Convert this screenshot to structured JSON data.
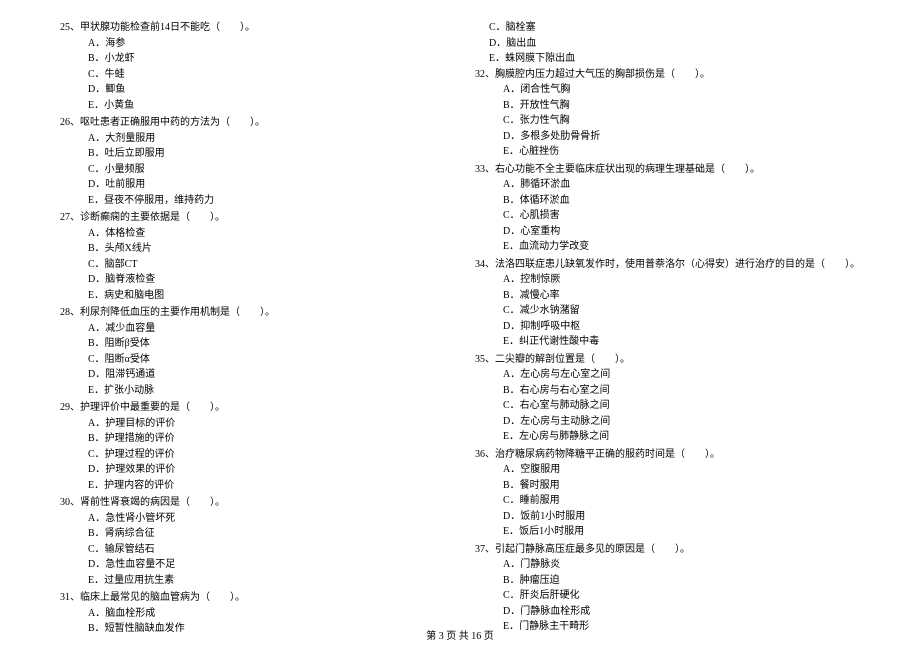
{
  "footer": "第 3 页 共 16 页",
  "left": {
    "questions": [
      {
        "num": "25、",
        "stem": "甲状腺功能检查前14日不能吃（　　）。",
        "options": [
          "A．海参",
          "B．小龙虾",
          "C．牛蛙",
          "D．鲫鱼",
          "E．小黄鱼"
        ]
      },
      {
        "num": "26、",
        "stem": "呕吐患者正确服用中药的方法为（　　）。",
        "options": [
          "A．大剂量服用",
          "B．吐后立即服用",
          "C．小量频服",
          "D．吐前服用",
          "E．昼夜不停服用，维持药力"
        ]
      },
      {
        "num": "27、",
        "stem": "诊断癫痫的主要依据是（　　）。",
        "options": [
          "A．体格检查",
          "B．头颅X线片",
          "C．脑部CT",
          "D．脑脊液检查",
          "E．病史和脑电图"
        ]
      },
      {
        "num": "28、",
        "stem": "利尿剂降低血压的主要作用机制是（　　）。",
        "options": [
          "A．减少血容量",
          "B．阻断β受体",
          "C．阻断α受体",
          "D．阻滞钙通道",
          "E．扩张小动脉"
        ]
      },
      {
        "num": "29、",
        "stem": "护理评价中最重要的是（　　）。",
        "options": [
          "A．护理目标的评价",
          "B．护理措施的评价",
          "C．护理过程的评价",
          "D．护理效果的评价",
          "E．护理内容的评价"
        ]
      },
      {
        "num": "30、",
        "stem": "肾前性肾衰竭的病因是（　　）。",
        "options": [
          "A．急性肾小管坏死",
          "B．肾病综合征",
          "C．输尿管结石",
          "D．急性血容量不足",
          "E．过量应用抗生素"
        ]
      },
      {
        "num": "31、",
        "stem": "临床上最常见的脑血管病为（　　）。",
        "options": [
          "A．脑血栓形成",
          "B．短暂性脑缺血发作"
        ]
      }
    ]
  },
  "right": {
    "continued_options": [
      "C．脑栓塞",
      "D．脑出血",
      "E．蛛网膜下隙出血"
    ],
    "questions": [
      {
        "num": "32、",
        "stem": "胸膜腔内压力超过大气压的胸部损伤是（　　）。",
        "options": [
          "A．闭合性气胸",
          "B．开放性气胸",
          "C．张力性气胸",
          "D．多根多处肋骨骨折",
          "E．心脏挫伤"
        ]
      },
      {
        "num": "33、",
        "stem": "右心功能不全主要临床症状出现的病理生理基础是（　　）。",
        "options": [
          "A．肺循环淤血",
          "B．体循环淤血",
          "C．心肌损害",
          "D．心室重构",
          "E．血流动力学改变"
        ]
      },
      {
        "num": "34、",
        "stem": "法洛四联症患儿缺氧发作时，使用普萘洛尔（心得安）进行治疗的目的是（　　）。",
        "options": [
          "A．控制惊厥",
          "B．减慢心率",
          "C．减少水钠潴留",
          "D．抑制呼吸中枢",
          "E．纠正代谢性酸中毒"
        ]
      },
      {
        "num": "35、",
        "stem": "二尖瓣的解剖位置是（　　）。",
        "options": [
          "A．左心房与左心室之间",
          "B．右心房与右心室之间",
          "C．右心室与肺动脉之间",
          "D．左心房与主动脉之间",
          "E．左心房与肺静脉之间"
        ]
      },
      {
        "num": "36、",
        "stem": "治疗糖尿病药物降糖平正确的服药时间是（　　）。",
        "options": [
          "A．空腹服用",
          "B．餐时服用",
          "C．睡前服用",
          "D．饭前1小时服用",
          "E．饭后1小时服用"
        ]
      },
      {
        "num": "37、",
        "stem": "引起门静脉高压症最多见的原因是（　　）。",
        "options": [
          "A．门静脉炎",
          "B．肿瘤压迫",
          "C．肝炎后肝硬化",
          "D．门静脉血栓形成",
          "E．门静脉主干畸形"
        ]
      }
    ]
  }
}
